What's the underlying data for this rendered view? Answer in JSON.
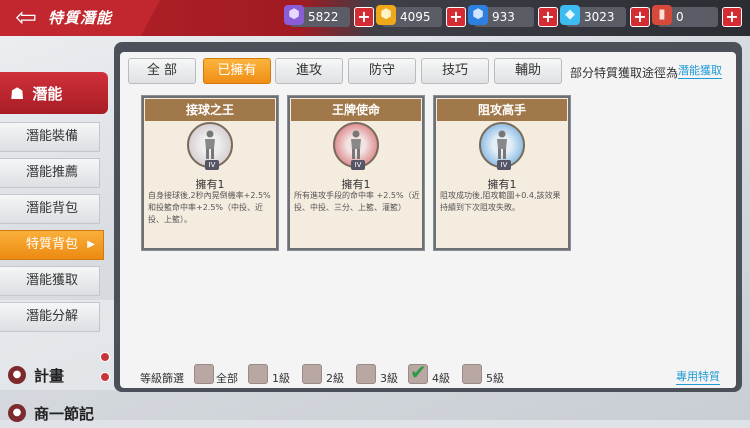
{
  "header": {
    "title": "特質潛能",
    "currencies": [
      {
        "value": "5822",
        "icon": "purple-gem-icon",
        "color": "#8a5cd6",
        "glyph": "⬢"
      },
      {
        "value": "4095",
        "icon": "gold-coin-icon",
        "color": "#f0a81b",
        "glyph": "⬢"
      },
      {
        "value": "933",
        "icon": "blue-coin-icon",
        "color": "#2d7fe0",
        "glyph": "⬢"
      },
      {
        "value": "3023",
        "icon": "diamond-icon",
        "color": "#3cbcf0",
        "glyph": "◆"
      },
      {
        "value": "0",
        "icon": "ticket-icon",
        "color": "#d64a3b",
        "glyph": "▮"
      }
    ]
  },
  "sidebar": {
    "main": {
      "label": "潛能"
    },
    "items": [
      {
        "label": "潛能裝備"
      },
      {
        "label": "潛能推薦"
      },
      {
        "label": "潛能背包"
      },
      {
        "label": "特質背包"
      },
      {
        "label": "潛能獲取"
      },
      {
        "label": "潛能分解"
      }
    ],
    "sub": [
      {
        "label": "計畫"
      },
      {
        "label": "商一節記"
      }
    ]
  },
  "tabs": [
    {
      "label": "全 部"
    },
    {
      "label": "已擁有"
    },
    {
      "label": "進攻"
    },
    {
      "label": "防守"
    },
    {
      "label": "技巧"
    },
    {
      "label": "輔助"
    }
  ],
  "hint": {
    "text": "部分特質獲取途徑為",
    "link": "潛能獲取"
  },
  "cards": [
    {
      "title": "接球之王",
      "own": "擁有1",
      "level": "IV",
      "ring_color": "#c8bcc0",
      "desc": "自身接球後,2秒內晃倒機率+2.5%和投籃命中率+2.5%（中投、近投、上籃）。"
    },
    {
      "title": "王牌使命",
      "own": "擁有1",
      "level": "IV",
      "ring_color": "#d2585c",
      "desc": "所有進攻手段的命中率 +2.5%（近投、中投、三分、上籃、灌籃）"
    },
    {
      "title": "阻攻高手",
      "own": "擁有1",
      "level": "IV",
      "ring_color": "#5a9fd8",
      "desc": "阻攻成功後,阻攻範圍+0.4,該效果持續到下次阻攻失敗。"
    }
  ],
  "filter": {
    "label": "等級篩選",
    "options": [
      {
        "label": "全部",
        "checked": false
      },
      {
        "label": "1級",
        "checked": false
      },
      {
        "label": "2級",
        "checked": false
      },
      {
        "label": "3級",
        "checked": false
      },
      {
        "label": "4級",
        "checked": true
      },
      {
        "label": "5級",
        "checked": false
      }
    ]
  },
  "footer_link": "專用特質"
}
